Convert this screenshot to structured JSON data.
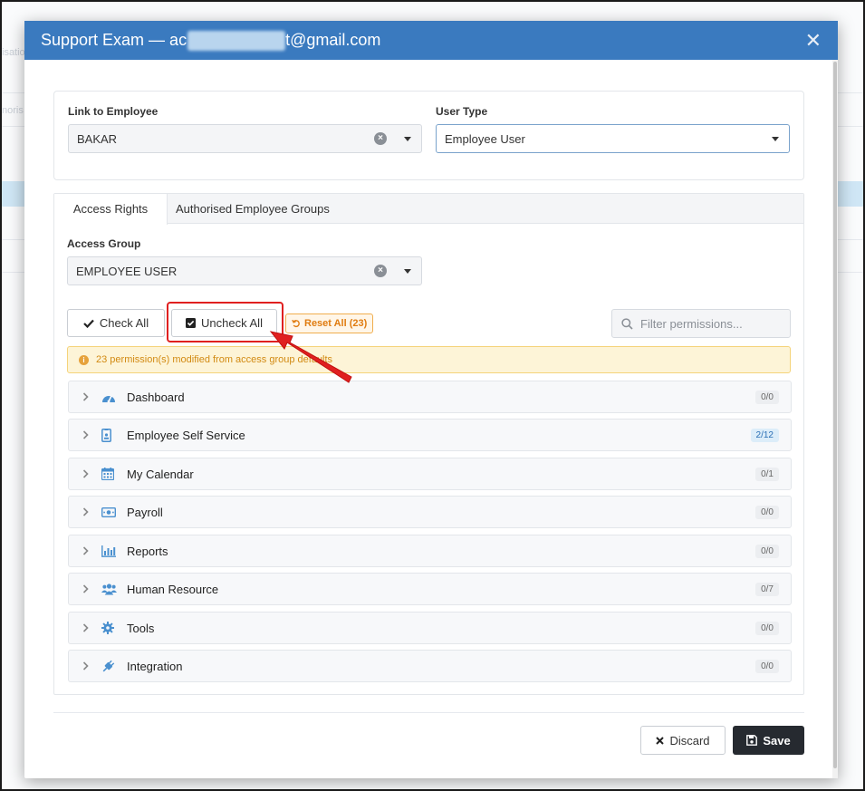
{
  "modal": {
    "title_prefix": "Support Exam — ac",
    "title_suffix": "t@gmail.com",
    "close_glyph": "✕"
  },
  "employee": {
    "link_label": "Link to Employee",
    "link_value": "BAKAR",
    "user_type_label": "User Type",
    "user_type_value": "Employee User"
  },
  "tabs": [
    {
      "label": "Access Rights",
      "active": true
    },
    {
      "label": "Authorised Employee Groups",
      "active": false
    }
  ],
  "access_group": {
    "label": "Access Group",
    "value": "EMPLOYEE USER"
  },
  "toolbar": {
    "check_all": "Check All",
    "uncheck_all": "Uncheck All",
    "reset_all": "Reset All (23)",
    "filter_placeholder": "Filter permissions..."
  },
  "alert": {
    "text": "23 permission(s) modified from access group defaults"
  },
  "permissions": [
    {
      "name": "Dashboard",
      "badge": "0/0",
      "icon": "dashboard-icon"
    },
    {
      "name": "Employee Self Service",
      "badge": "2/12",
      "icon": "id-badge-icon",
      "highlight": true
    },
    {
      "name": "My Calendar",
      "badge": "0/1",
      "icon": "calendar-icon"
    },
    {
      "name": "Payroll",
      "badge": "0/0",
      "icon": "money-icon"
    },
    {
      "name": "Reports",
      "badge": "0/0",
      "icon": "bar-chart-icon"
    },
    {
      "name": "Human Resource",
      "badge": "0/7",
      "icon": "users-icon"
    },
    {
      "name": "Tools",
      "badge": "0/0",
      "icon": "gear-icon"
    },
    {
      "name": "Integration",
      "badge": "0/0",
      "icon": "plug-icon"
    }
  ],
  "footer": {
    "discard": "Discard",
    "save": "Save"
  },
  "background": {
    "fragment_1": "isatio",
    "fragment_2": "noris"
  },
  "colors": {
    "header": "#3a7abf",
    "icon_blue": "#4a90cf",
    "annotation_red": "#e02020"
  }
}
